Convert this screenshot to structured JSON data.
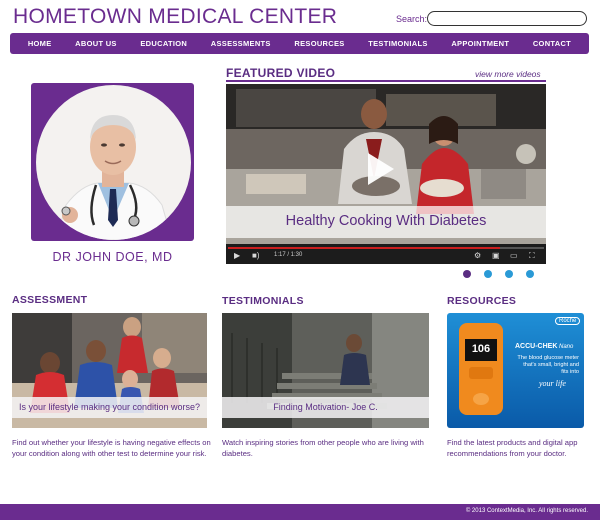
{
  "header": {
    "title": "HOMETOWN MEDICAL CENTER",
    "search_label": "Search:",
    "search_value": ""
  },
  "nav": [
    "HOME",
    "ABOUT US",
    "EDUCATION",
    "ASSESSMENTS",
    "RESOURCES",
    "TESTIMONIALS",
    "APPOINTMENT",
    "CONTACT"
  ],
  "doctor": {
    "name": "DR JOHN DOE, MD"
  },
  "featured": {
    "title": "FEATURED VIDEO",
    "view_more": "view more videos",
    "caption": "Healthy Cooking With Diabetes",
    "time": "1:17 / 1:30",
    "progress": 0.86,
    "slides": 4,
    "active_slide": 0
  },
  "assessment": {
    "title": "ASSESSMENT",
    "caption": "Is your lifestyle making your condition worse?",
    "desc": "Find out whether your lifestyle is having negative effects on your condition along with other test to determine your risk."
  },
  "testimonials": {
    "title": "TESTIMONIALS",
    "caption": "Finding Motivation- Joe C.",
    "desc": "Watch inspiring stories from other people who are living with diabetes."
  },
  "resources": {
    "title": "RESOURCES",
    "brand": "ACCU-CHEK",
    "product": "Nano",
    "reading": "106",
    "tagline": "The blood glucose meter that's small, bright and fits into",
    "tagline_script": "your life",
    "logo": "Roche",
    "desc": "Find the latest products and digital app recommendations from your doctor."
  },
  "footer": {
    "copyright": "© 2013 ContextMedia, Inc. All rights reserved."
  },
  "colors": {
    "brand_purple": "#6a2c8f",
    "dot_active": "#5a2d82",
    "dot_inactive": "#2a9ad6",
    "progress_red": "#cc1f1f"
  },
  "icons": [
    "play-icon",
    "volume-icon",
    "settings-icon",
    "fullscreen-icon"
  ]
}
